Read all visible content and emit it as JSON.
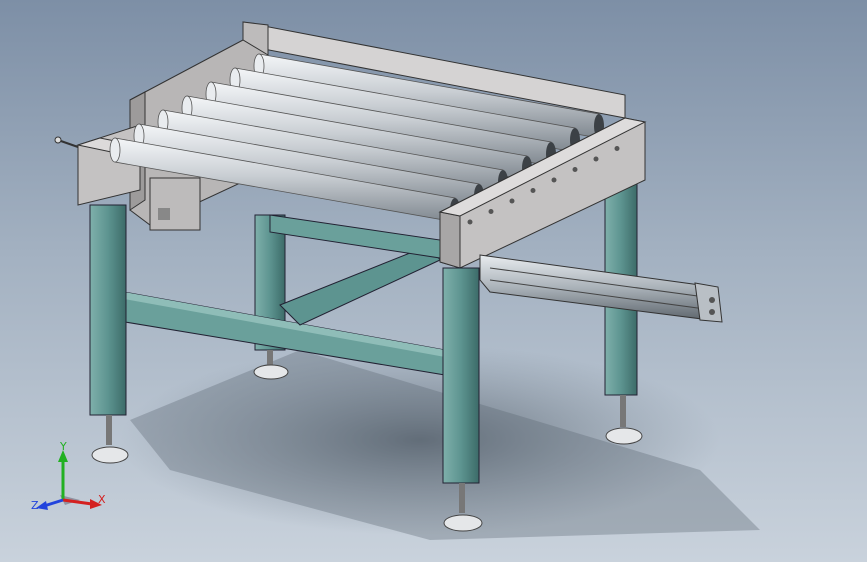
{
  "view": {
    "background_top": "#7d8fa6",
    "background_bottom": "#c9d2dc"
  },
  "model": {
    "frame_color": "#5d9490",
    "plate_color": "#c4c2c2",
    "roller_color": "#c9ced3",
    "roller_count": 7
  },
  "triad": {
    "x_label": "X",
    "y_label": "Y",
    "z_label": "Z",
    "x_color": "#d42020",
    "y_color": "#22b022",
    "z_color": "#2244dd"
  }
}
